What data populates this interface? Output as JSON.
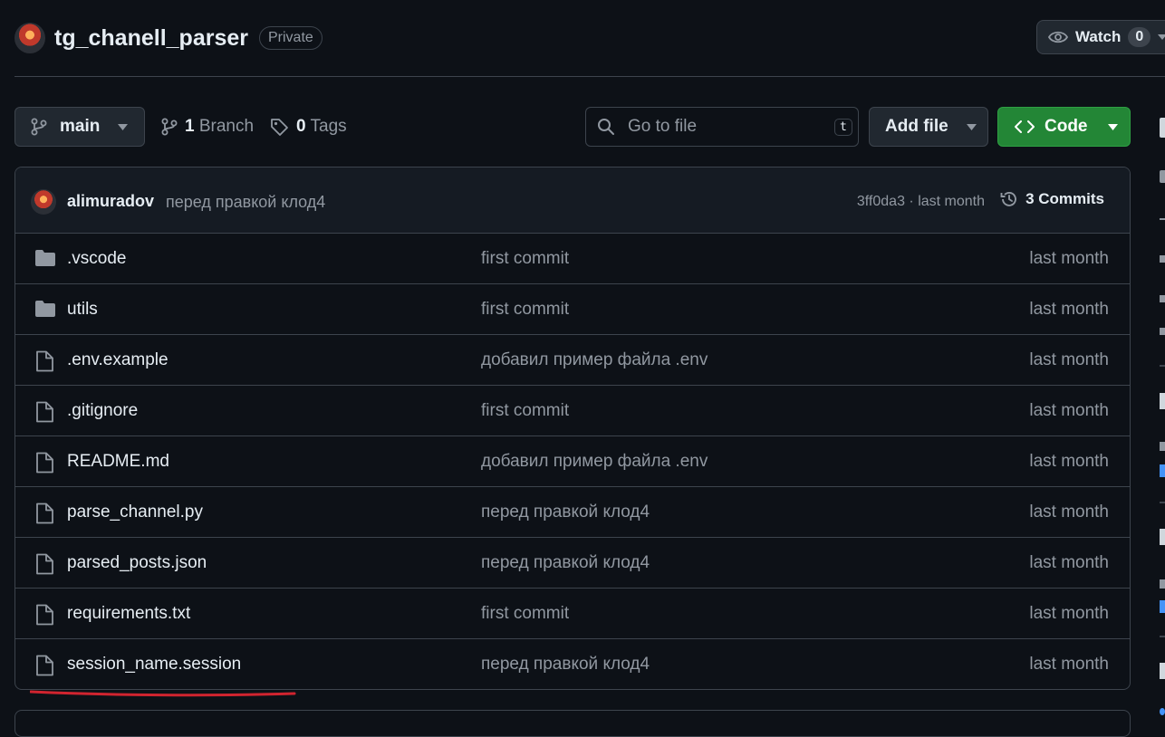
{
  "header": {
    "repo_name": "tg_chanell_parser",
    "visibility": "Private",
    "watch_label": "Watch",
    "watch_count": "0"
  },
  "toolbar": {
    "branch": "main",
    "branch_count": "1",
    "branch_label": "Branch",
    "tag_count": "0",
    "tag_label": "Tags",
    "search_placeholder": "Go to file",
    "search_shortcut": "t",
    "add_file_label": "Add file",
    "code_label": "Code"
  },
  "latest_commit": {
    "author": "alimuradov",
    "message": "перед правкой клод4",
    "hash_time": "3ff0da3 · last month",
    "commits_label": "3 Commits"
  },
  "files": [
    {
      "name": ".vscode",
      "type": "folder",
      "message": "first commit",
      "date": "last month"
    },
    {
      "name": "utils",
      "type": "folder",
      "message": "first commit",
      "date": "last month"
    },
    {
      "name": ".env.example",
      "type": "file",
      "message": "добавил пример файла .env",
      "date": "last month"
    },
    {
      "name": ".gitignore",
      "type": "file",
      "message": "first commit",
      "date": "last month"
    },
    {
      "name": "README.md",
      "type": "file",
      "message": "добавил пример файла .env",
      "date": "last month"
    },
    {
      "name": "parse_channel.py",
      "type": "file",
      "message": "перед правкой клод4",
      "date": "last month"
    },
    {
      "name": "parsed_posts.json",
      "type": "file",
      "message": "перед правкой клод4",
      "date": "last month"
    },
    {
      "name": "requirements.txt",
      "type": "file",
      "message": "first commit",
      "date": "last month"
    },
    {
      "name": "session_name.session",
      "type": "file",
      "message": "перед правкой клод4",
      "date": "last month"
    }
  ],
  "colors": {
    "background": "#0d1117",
    "border": "#3d444d",
    "code_button": "#238636",
    "annotation_underline": "#d1242f"
  }
}
